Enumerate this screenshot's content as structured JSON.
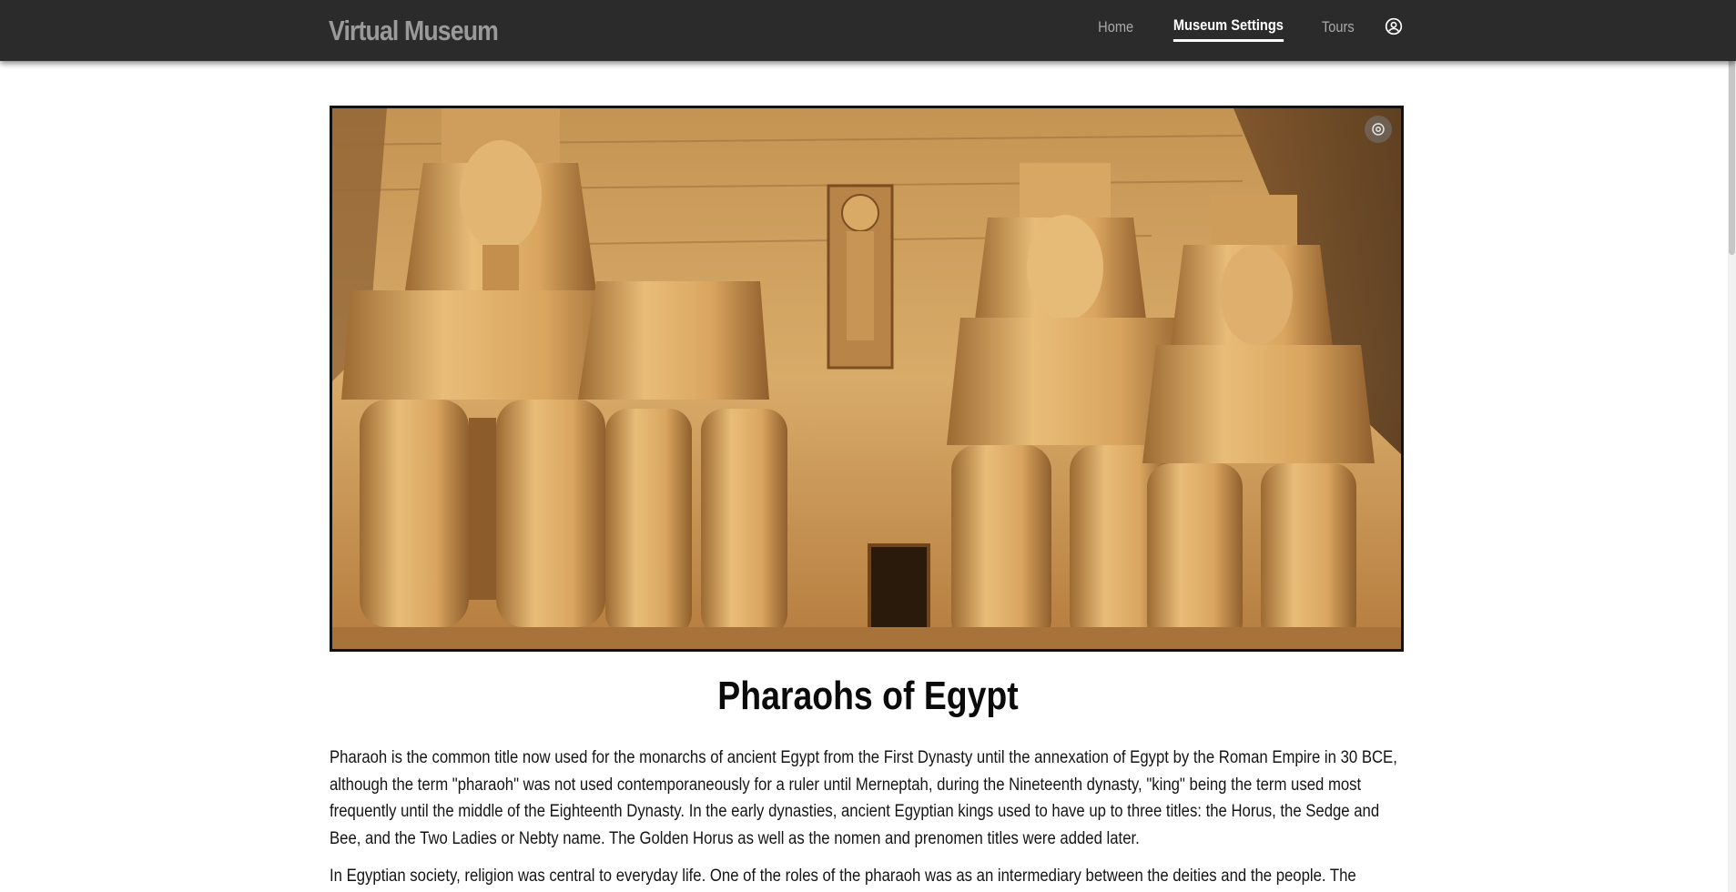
{
  "navbar": {
    "brand": "Virtual Museum",
    "links": [
      {
        "label": "Home",
        "active": false
      },
      {
        "label": "Museum Settings",
        "active": true
      },
      {
        "label": "Tours",
        "active": false
      }
    ],
    "account_icon": "account-circle-icon"
  },
  "hero": {
    "alt": "Colossal statues at the entrance of the Abu Simbel temple",
    "corner_icon": "camera-icon"
  },
  "page": {
    "title": "Pharaohs of Egypt",
    "paragraphs": [
      "Pharaoh is the common title now used for the monarchs of ancient Egypt from the First Dynasty until the annexation of Egypt by the Roman Empire in 30 BCE, although the term \"pharaoh\" was not used contemporaneously for a ruler until Merneptah, during the Nineteenth dynasty, \"king\" being the term used most frequently until the middle of the Eighteenth Dynasty. In the early dynasties, ancient Egyptian kings used to have up to three titles: the Horus, the Sedge and Bee, and the Two Ladies or Nebty name. The Golden Horus as well as the nomen and prenomen titles were added later.",
      "In Egyptian society, religion was central to everyday life. One of the roles of the pharaoh was as an intermediary between the deities and the people. The pharaoh"
    ]
  },
  "colors": {
    "navbar_bg": "#2b2b2b",
    "brand_text": "#9a9a9a",
    "nav_link": "#a9a9a9",
    "nav_link_active": "#ffffff",
    "stone": "#d4a35f"
  }
}
